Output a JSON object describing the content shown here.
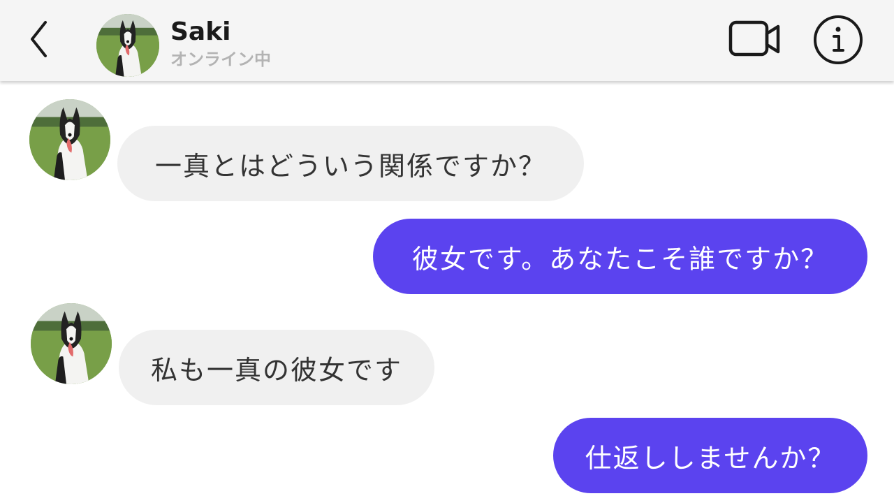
{
  "header": {
    "contact_name": "Saki",
    "status": "オンライン中",
    "back_icon": "chevron-left-icon",
    "video_icon": "video-camera-icon",
    "info_icon": "info-icon"
  },
  "messages": [
    {
      "direction": "received",
      "text": "一真とはどういう関係ですか？"
    },
    {
      "direction": "sent",
      "text": "彼女です。あなたこそ誰ですか？"
    },
    {
      "direction": "received",
      "text": "私も一真の彼女です"
    },
    {
      "direction": "sent",
      "text": "仕返ししませんか？"
    }
  ],
  "colors": {
    "sent_bubble": "#5b43ef",
    "received_bubble": "#f0f0f0",
    "header_bg": "#f5f5f5",
    "status_text": "#b3b3b3"
  }
}
